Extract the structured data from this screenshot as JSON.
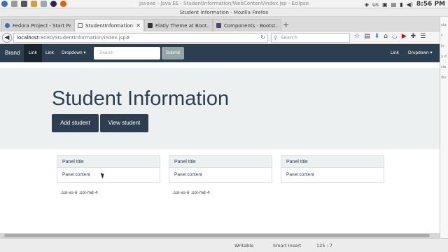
{
  "system": {
    "window_title": "Javaee - Java EE - StudentInformation/WebContent/index.jsp - Eclipse",
    "keyboard_layout": "us",
    "clock": "8:56 PM"
  },
  "browser": {
    "window_title": "Student Information - Mozilla Firefox",
    "tabs": [
      {
        "label": "Fedora Project - Start Page",
        "favicon": "fedora-icon",
        "active": false
      },
      {
        "label": "StudentInformation",
        "favicon": "page-icon",
        "active": true
      },
      {
        "label": "Flatly Theme at Boot...",
        "favicon": "bootswatch-icon",
        "active": false
      },
      {
        "label": "Components · Bootst...",
        "favicon": "bootstrap-icon",
        "active": false
      }
    ],
    "url_host": "localhost",
    "url_rest": ":8080/StudentInformation/index.jsp#",
    "search_placeholder": "Search"
  },
  "navbar": {
    "brand": "Brand",
    "links_left": [
      "Link",
      "Link",
      "Dropdown ▾"
    ],
    "search_placeholder": "Search",
    "submit_label": "Submit",
    "links_right": [
      "Link",
      "Dropdown ▾"
    ],
    "color": "#2c3e50"
  },
  "jumbotron": {
    "title": "Student Information",
    "buttons": [
      "Add student",
      "View student"
    ]
  },
  "panels": [
    {
      "title": "Panel title",
      "content": "Panel content",
      "column_label": ".col-xs-6 .col-md-4"
    },
    {
      "title": "Panel title",
      "content": "Panel content",
      "column_label": ".col-xs-6 .col-md-4"
    },
    {
      "title": "Panel title",
      "content": "Panel content",
      "column_label": ""
    }
  ],
  "eclipse_status": {
    "mode": "Writable",
    "insert": "Smart Insert",
    "position": "125 : 7"
  }
}
